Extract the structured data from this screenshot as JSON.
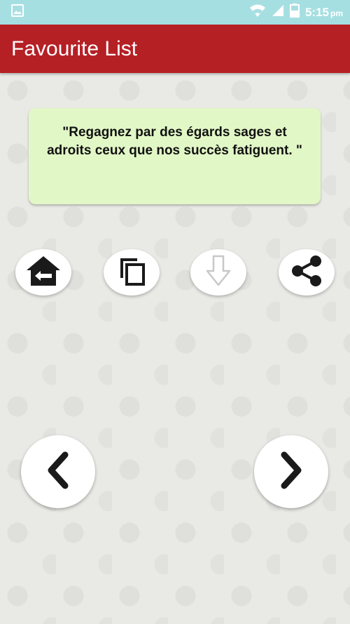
{
  "status_bar": {
    "time": "5:15",
    "ampm": "pm",
    "icons": [
      "image-icon",
      "wifi-icon",
      "signal-icon",
      "battery-icon"
    ]
  },
  "app_bar": {
    "title": "Favourite List",
    "color": "#b52025"
  },
  "quote": {
    "text": "\"Regagnez par des égards sages et adroits ceux que nos succès fatiguent. \"",
    "background": "#e2f7c6"
  },
  "actions": {
    "icons": [
      "home-back-icon",
      "copy-icon",
      "download-icon",
      "share-icon"
    ]
  },
  "navigation": {
    "icons": [
      "chevron-left-icon",
      "chevron-right-icon"
    ]
  }
}
